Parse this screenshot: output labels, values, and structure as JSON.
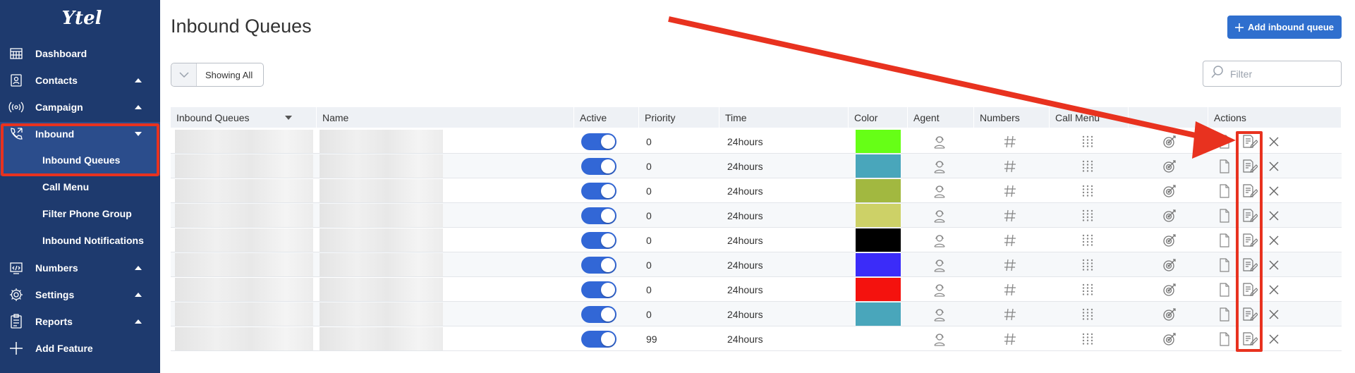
{
  "brand": {
    "logo_text": "Ytel"
  },
  "sidebar": {
    "items": [
      {
        "label": "Dashboard",
        "icon": "dashboard-icon"
      },
      {
        "label": "Contacts",
        "icon": "contacts-icon"
      },
      {
        "label": "Campaign",
        "icon": "campaign-icon"
      },
      {
        "label": "Inbound",
        "icon": "phone-icon"
      },
      {
        "label": "Numbers",
        "icon": "numbers-icon"
      },
      {
        "label": "Settings",
        "icon": "gear-icon"
      },
      {
        "label": "Reports",
        "icon": "reports-icon"
      },
      {
        "label": "Add Feature",
        "icon": "plus-icon"
      }
    ],
    "inbound_sub": [
      {
        "label": "Inbound Queues"
      },
      {
        "label": "Call Menu"
      },
      {
        "label": "Filter Phone Group"
      },
      {
        "label": "Inbound Notifications"
      }
    ]
  },
  "header": {
    "title": "Inbound Queues",
    "add_button": "Add inbound queue",
    "showing": "Showing All",
    "filter_placeholder": "Filter"
  },
  "table": {
    "columns": [
      "Inbound Queues",
      "Name",
      "Active",
      "Priority",
      "Time",
      "Color",
      "Agent",
      "Numbers",
      "Call Menu",
      "",
      "Actions"
    ],
    "rows": [
      {
        "active": true,
        "priority": "0",
        "time": "24hours",
        "color": "#66ff16"
      },
      {
        "active": true,
        "priority": "0",
        "time": "24hours",
        "color": "#49a6bb"
      },
      {
        "active": true,
        "priority": "0",
        "time": "24hours",
        "color": "#a2b840"
      },
      {
        "active": true,
        "priority": "0",
        "time": "24hours",
        "color": "#cdd167"
      },
      {
        "active": true,
        "priority": "0",
        "time": "24hours",
        "color": "#000000"
      },
      {
        "active": true,
        "priority": "0",
        "time": "24hours",
        "color": "#3b2cf9"
      },
      {
        "active": true,
        "priority": "0",
        "time": "24hours",
        "color": "#f4120e"
      },
      {
        "active": true,
        "priority": "0",
        "time": "24hours",
        "color": "#49a6bb"
      },
      {
        "active": true,
        "priority": "99",
        "time": "24hours",
        "color": ""
      }
    ]
  },
  "colors": {
    "sidebar": "#1e3a6e",
    "accent": "#2f6fce",
    "annotation": "#e8321f",
    "toggle_on": "#3267d6"
  }
}
